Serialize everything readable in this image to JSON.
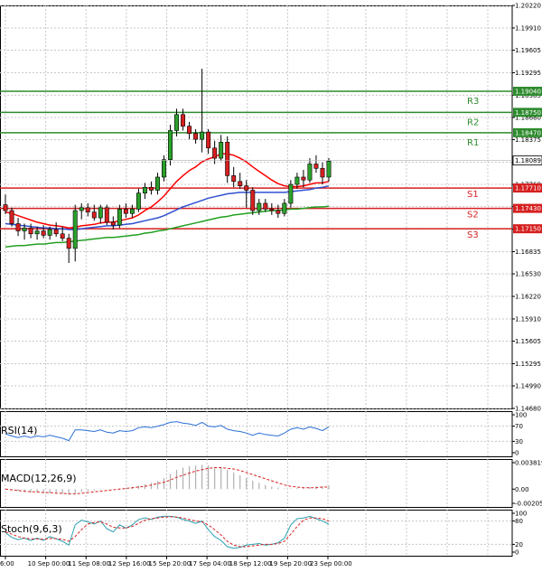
{
  "chart_data": {
    "type": "candlestick",
    "symbol_hint": "",
    "price_axis": {
      "ticks": [
        "1.20220",
        "1.19910",
        "1.19605",
        "1.19295",
        "1.18985",
        "1.18680",
        "1.18375",
        "1.18065",
        "1.17760",
        "1.17455",
        "1.17145",
        "1.16835",
        "1.16530",
        "1.16220",
        "1.15910",
        "1.15605",
        "1.15295",
        "1.14990",
        "1.14680"
      ],
      "range": [
        1.1468,
        1.2022
      ],
      "current_price": "1.18089",
      "current_price_value": 1.18089
    },
    "levels": [
      {
        "label": "R3",
        "value": 1.1904,
        "value_text": "1.19040",
        "kind": "resistance"
      },
      {
        "label": "R2",
        "value": 1.1875,
        "value_text": "1.18750",
        "kind": "resistance"
      },
      {
        "label": "R1",
        "value": 1.1847,
        "value_text": "1.18470",
        "kind": "resistance"
      },
      {
        "label": "S1",
        "value": 1.1771,
        "value_text": "1.17710",
        "kind": "support"
      },
      {
        "label": "S2",
        "value": 1.1743,
        "value_text": "1.17430",
        "kind": "support"
      },
      {
        "label": "S3",
        "value": 1.1715,
        "value_text": "1.17150",
        "kind": "support"
      }
    ],
    "candles": [
      {
        "o": 1.1748,
        "h": 1.1762,
        "l": 1.1735,
        "c": 1.174
      },
      {
        "o": 1.174,
        "h": 1.1744,
        "l": 1.1718,
        "c": 1.1722
      },
      {
        "o": 1.1722,
        "h": 1.173,
        "l": 1.1705,
        "c": 1.1712
      },
      {
        "o": 1.1712,
        "h": 1.1722,
        "l": 1.17,
        "c": 1.1716
      },
      {
        "o": 1.1716,
        "h": 1.1722,
        "l": 1.1702,
        "c": 1.1708
      },
      {
        "o": 1.1708,
        "h": 1.1718,
        "l": 1.17,
        "c": 1.1712
      },
      {
        "o": 1.1712,
        "h": 1.172,
        "l": 1.1702,
        "c": 1.1706
      },
      {
        "o": 1.1706,
        "h": 1.1718,
        "l": 1.17,
        "c": 1.1714
      },
      {
        "o": 1.1714,
        "h": 1.1724,
        "l": 1.1704,
        "c": 1.1708
      },
      {
        "o": 1.1708,
        "h": 1.1718,
        "l": 1.1698,
        "c": 1.1702
      },
      {
        "o": 1.1702,
        "h": 1.1708,
        "l": 1.1668,
        "c": 1.1688
      },
      {
        "o": 1.1688,
        "h": 1.1748,
        "l": 1.167,
        "c": 1.174
      },
      {
        "o": 1.174,
        "h": 1.175,
        "l": 1.1728,
        "c": 1.1744
      },
      {
        "o": 1.1744,
        "h": 1.175,
        "l": 1.1732,
        "c": 1.1738
      },
      {
        "o": 1.1738,
        "h": 1.1748,
        "l": 1.1726,
        "c": 1.173
      },
      {
        "o": 1.173,
        "h": 1.1748,
        "l": 1.1722,
        "c": 1.1744
      },
      {
        "o": 1.1744,
        "h": 1.1748,
        "l": 1.172,
        "c": 1.1724
      },
      {
        "o": 1.1724,
        "h": 1.1732,
        "l": 1.1714,
        "c": 1.172
      },
      {
        "o": 1.172,
        "h": 1.1748,
        "l": 1.1716,
        "c": 1.1742
      },
      {
        "o": 1.1742,
        "h": 1.175,
        "l": 1.173,
        "c": 1.1736
      },
      {
        "o": 1.1736,
        "h": 1.1748,
        "l": 1.173,
        "c": 1.1742
      },
      {
        "o": 1.1742,
        "h": 1.177,
        "l": 1.1738,
        "c": 1.1764
      },
      {
        "o": 1.1764,
        "h": 1.1778,
        "l": 1.1756,
        "c": 1.1772
      },
      {
        "o": 1.1772,
        "h": 1.178,
        "l": 1.1762,
        "c": 1.1768
      },
      {
        "o": 1.1768,
        "h": 1.1792,
        "l": 1.1762,
        "c": 1.1786
      },
      {
        "o": 1.1786,
        "h": 1.1816,
        "l": 1.178,
        "c": 1.181
      },
      {
        "o": 1.181,
        "h": 1.1858,
        "l": 1.1802,
        "c": 1.185
      },
      {
        "o": 1.185,
        "h": 1.188,
        "l": 1.1842,
        "c": 1.1872
      },
      {
        "o": 1.1872,
        "h": 1.188,
        "l": 1.185,
        "c": 1.1856
      },
      {
        "o": 1.1856,
        "h": 1.1862,
        "l": 1.1838,
        "c": 1.1846
      },
      {
        "o": 1.1846,
        "h": 1.1852,
        "l": 1.1832,
        "c": 1.1838
      },
      {
        "o": 1.1838,
        "h": 1.1935,
        "l": 1.182,
        "c": 1.1848
      },
      {
        "o": 1.1848,
        "h": 1.1852,
        "l": 1.1818,
        "c": 1.1826
      },
      {
        "o": 1.1826,
        "h": 1.1836,
        "l": 1.1804,
        "c": 1.1812
      },
      {
        "o": 1.1812,
        "h": 1.1844,
        "l": 1.1808,
        "c": 1.1834
      },
      {
        "o": 1.1834,
        "h": 1.1842,
        "l": 1.1778,
        "c": 1.1788
      },
      {
        "o": 1.1788,
        "h": 1.18,
        "l": 1.1772,
        "c": 1.178
      },
      {
        "o": 1.178,
        "h": 1.1792,
        "l": 1.177,
        "c": 1.1774
      },
      {
        "o": 1.1774,
        "h": 1.1782,
        "l": 1.1744,
        "c": 1.1768
      },
      {
        "o": 1.1768,
        "h": 1.1772,
        "l": 1.1734,
        "c": 1.174
      },
      {
        "o": 1.174,
        "h": 1.1756,
        "l": 1.1734,
        "c": 1.175
      },
      {
        "o": 1.175,
        "h": 1.1756,
        "l": 1.1738,
        "c": 1.1742
      },
      {
        "o": 1.1742,
        "h": 1.175,
        "l": 1.1734,
        "c": 1.174
      },
      {
        "o": 1.174,
        "h": 1.1748,
        "l": 1.173,
        "c": 1.1736
      },
      {
        "o": 1.1736,
        "h": 1.1756,
        "l": 1.1732,
        "c": 1.175
      },
      {
        "o": 1.175,
        "h": 1.1782,
        "l": 1.1744,
        "c": 1.1776
      },
      {
        "o": 1.1776,
        "h": 1.1792,
        "l": 1.177,
        "c": 1.1786
      },
      {
        "o": 1.1786,
        "h": 1.1796,
        "l": 1.1772,
        "c": 1.1782
      },
      {
        "o": 1.1782,
        "h": 1.1812,
        "l": 1.1778,
        "c": 1.1804
      },
      {
        "o": 1.1804,
        "h": 1.1816,
        "l": 1.1792,
        "c": 1.1798
      },
      {
        "o": 1.1798,
        "h": 1.1806,
        "l": 1.1776,
        "c": 1.1786
      },
      {
        "o": 1.1786,
        "h": 1.1812,
        "l": 1.178,
        "c": 1.1808
      }
    ],
    "moving_averages": [
      {
        "color": "#ff0000",
        "values": [
          1.1738,
          1.1736,
          1.1733,
          1.173,
          1.1727,
          1.1724,
          1.1722,
          1.172,
          1.1719,
          1.1718,
          1.1716,
          1.1717,
          1.1719,
          1.172,
          1.1721,
          1.1723,
          1.1724,
          1.1724,
          1.1726,
          1.1728,
          1.173,
          1.1734,
          1.174,
          1.1745,
          1.1752,
          1.176,
          1.177,
          1.178,
          1.1788,
          1.1795,
          1.18,
          1.1807,
          1.1811,
          1.1814,
          1.1818,
          1.1818,
          1.1816,
          1.1812,
          1.1807,
          1.18,
          1.1794,
          1.1788,
          1.1782,
          1.1777,
          1.1774,
          1.1773,
          1.1773,
          1.1774,
          1.1776,
          1.1778,
          1.1778,
          1.178
        ]
      },
      {
        "color": "#3050d0",
        "values": [
          1.1722,
          1.1721,
          1.172,
          1.1719,
          1.1718,
          1.1717,
          1.1716,
          1.1716,
          1.1715,
          1.1715,
          1.1714,
          1.1714,
          1.1715,
          1.1716,
          1.1717,
          1.1718,
          1.1719,
          1.1719,
          1.172,
          1.1721,
          1.1722,
          1.1724,
          1.1726,
          1.1728,
          1.173,
          1.1733,
          1.1737,
          1.1741,
          1.1745,
          1.1748,
          1.1751,
          1.1754,
          1.1757,
          1.1759,
          1.1761,
          1.1763,
          1.1764,
          1.1765,
          1.1765,
          1.1765,
          1.1765,
          1.1765,
          1.1765,
          1.1765,
          1.1765,
          1.1766,
          1.1767,
          1.1768,
          1.1769,
          1.1771,
          1.1772,
          1.1774
        ]
      },
      {
        "color": "#22a022",
        "values": [
          1.169,
          1.1691,
          1.1692,
          1.1692,
          1.1693,
          1.1694,
          1.1694,
          1.1695,
          1.1696,
          1.1696,
          1.1697,
          1.1698,
          1.1699,
          1.17,
          1.1701,
          1.1702,
          1.1703,
          1.1703,
          1.1704,
          1.1705,
          1.1706,
          1.1707,
          1.1709,
          1.171,
          1.1712,
          1.1713,
          1.1715,
          1.1717,
          1.1719,
          1.1721,
          1.1723,
          1.1725,
          1.1727,
          1.1729,
          1.1731,
          1.1732,
          1.1734,
          1.1735,
          1.1736,
          1.1737,
          1.1738,
          1.1739,
          1.174,
          1.174,
          1.1741,
          1.1742,
          1.1742,
          1.1743,
          1.1744,
          1.1745,
          1.1745,
          1.1746
        ]
      }
    ],
    "x_axis_labels": [
      "6:00",
      "10 Sep 00:00",
      "11 Sep 08:00",
      "12 Sep 16:00",
      "15 Sep 20:00",
      "17 Sep 04:00",
      "18 Sep 12:00",
      "19 Sep 20:00",
      "23 Sep 00:00"
    ],
    "indicators": [
      {
        "name": "RSI(14)",
        "ticks": [
          "100",
          "70",
          "30",
          "0"
        ],
        "range": [
          0,
          100
        ],
        "color": "#2a6fd6",
        "values": [
          50,
          44,
          40,
          44,
          40,
          44,
          42,
          46,
          42,
          38,
          32,
          60,
          60,
          58,
          56,
          60,
          54,
          52,
          58,
          56,
          58,
          66,
          68,
          66,
          70,
          74,
          80,
          82,
          78,
          76,
          72,
          80,
          70,
          68,
          72,
          62,
          58,
          56,
          52,
          46,
          52,
          48,
          46,
          44,
          52,
          62,
          66,
          62,
          68,
          64,
          58,
          68
        ]
      },
      {
        "name": "MACD(12,26,9)",
        "ticks": [
          "0.003819",
          "0.00",
          "-0.002051"
        ],
        "range": [
          -0.002051,
          0.003819
        ],
        "bar_color": "#b0b0b0",
        "signal_color": "#d62020",
        "histogram": [
          0.0,
          -0.0002,
          -0.0003,
          -0.0004,
          -0.0005,
          -0.0005,
          -0.0006,
          -0.0006,
          -0.0006,
          -0.0007,
          -0.0008,
          -0.0006,
          -0.0004,
          -0.0003,
          -0.0002,
          -0.0001,
          0.0,
          0.0,
          0.0001,
          0.0002,
          0.0003,
          0.0005,
          0.0007,
          0.0009,
          0.0012,
          0.0016,
          0.0022,
          0.0028,
          0.0031,
          0.0033,
          0.0034,
          0.0035,
          0.0034,
          0.0032,
          0.0031,
          0.0028,
          0.0024,
          0.002,
          0.0016,
          0.0012,
          0.0009,
          0.0006,
          0.0004,
          0.0002,
          0.0001,
          0.0001,
          0.0002,
          0.0002,
          0.0003,
          0.0004,
          0.0004,
          0.0005
        ],
        "signal": [
          0.0,
          -0.0001,
          -0.0002,
          -0.0003,
          -0.0004,
          -0.0004,
          -0.0005,
          -0.0005,
          -0.0006,
          -0.0006,
          -0.0007,
          -0.0007,
          -0.0006,
          -0.0005,
          -0.0004,
          -0.0003,
          -0.0002,
          -0.0001,
          0.0,
          0.0001,
          0.0002,
          0.0003,
          0.0004,
          0.0006,
          0.0008,
          0.001,
          0.0013,
          0.0017,
          0.002,
          0.0023,
          0.0026,
          0.0028,
          0.003,
          0.0031,
          0.0031,
          0.003,
          0.0029,
          0.0027,
          0.0024,
          0.0021,
          0.0018,
          0.0015,
          0.0012,
          0.0009,
          0.0006,
          0.0004,
          0.0003,
          0.0002,
          0.0002,
          0.0002,
          0.0003,
          0.0003
        ]
      },
      {
        "name": "Stoch(9,6,3)",
        "ticks": [
          "100",
          "80",
          "20",
          "0"
        ],
        "range": [
          0,
          100
        ],
        "main_color": "#2aa0b0",
        "signal_color": "#d62020",
        "main": [
          50,
          38,
          32,
          36,
          30,
          36,
          30,
          40,
          34,
          28,
          18,
          70,
          82,
          78,
          72,
          80,
          60,
          52,
          70,
          62,
          70,
          84,
          88,
          84,
          90,
          92,
          92,
          90,
          84,
          80,
          74,
          80,
          58,
          40,
          30,
          14,
          10,
          12,
          18,
          20,
          22,
          18,
          20,
          24,
          36,
          70,
          86,
          88,
          92,
          86,
          80,
          72
        ],
        "signal": [
          52,
          46,
          40,
          36,
          34,
          34,
          33,
          35,
          35,
          33,
          28,
          40,
          58,
          72,
          76,
          78,
          72,
          64,
          62,
          62,
          66,
          74,
          82,
          86,
          88,
          90,
          91,
          90,
          88,
          84,
          80,
          78,
          70,
          58,
          44,
          28,
          18,
          14,
          14,
          16,
          18,
          20,
          20,
          22,
          28,
          46,
          66,
          82,
          88,
          88,
          86,
          80
        ]
      }
    ]
  }
}
